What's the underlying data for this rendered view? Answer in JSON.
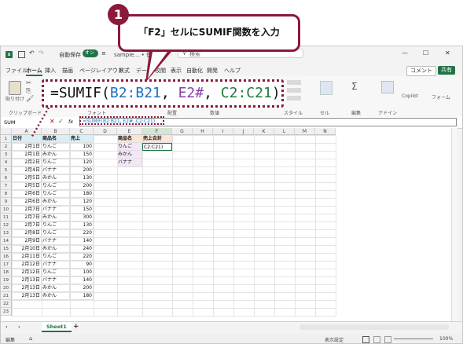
{
  "callout": {
    "badge": "1",
    "text": "「F2」セルにSUMIF関数を入力"
  },
  "zoom": {
    "prefix": "=SUMIF(",
    "ref1": "B2:B21",
    "sep1": ", ",
    "ref2": "E2#",
    "sep2": ", ",
    "ref3": "C2:C21",
    "suffix": ")"
  },
  "titlebar": {
    "autosave": "自動保存",
    "toggle": "オン",
    "filename": "sample… • 保存済み",
    "search": "検索"
  },
  "menu": [
    "ファイル",
    "ホーム",
    "挿入",
    "描画",
    "ページレイアウト",
    "数式",
    "データ",
    "校閲",
    "表示",
    "自動化",
    "開発",
    "ヘルプ"
  ],
  "ribbon": {
    "comment": "コメント",
    "share": "共有",
    "clipboard": "クリップボード",
    "paste": "貼り付け",
    "font": "フォント",
    "align": "配置",
    "number": "数値",
    "style": "スタイル",
    "cells": "セル",
    "edit": "編集",
    "addin": "アドイン",
    "copilot": "Copilot",
    "form": "フォーム"
  },
  "formula_bar": {
    "namebox": "SUM",
    "fx": "fx",
    "content": "=SUMIF(B2:B21, E2#, C2:C21)"
  },
  "columns": [
    "A",
    "B",
    "C",
    "D",
    "E",
    "F",
    "G",
    "H",
    "I",
    "J",
    "K",
    "L",
    "M",
    "N"
  ],
  "table": {
    "headers": [
      "日付",
      "商品名",
      "売上"
    ],
    "rows": [
      [
        "2月1日",
        "りんご",
        "100"
      ],
      [
        "2月1日",
        "みかん",
        "150"
      ],
      [
        "2月2日",
        "りんご",
        "120"
      ],
      [
        "2月4日",
        "バナナ",
        "200"
      ],
      [
        "2月5日",
        "みかん",
        "130"
      ],
      [
        "2月5日",
        "りんご",
        "200"
      ],
      [
        "2月6日",
        "りんご",
        "180"
      ],
      [
        "2月6日",
        "みかん",
        "120"
      ],
      [
        "2月7日",
        "バナナ",
        "150"
      ],
      [
        "2月7日",
        "みかん",
        "300"
      ],
      [
        "2月7日",
        "りんご",
        "130"
      ],
      [
        "2月8日",
        "りんご",
        "220"
      ],
      [
        "2月9日",
        "バナナ",
        "140"
      ],
      [
        "2月10日",
        "みかん",
        "240"
      ],
      [
        "2月11日",
        "りんご",
        "220"
      ],
      [
        "2月12日",
        "バナナ",
        "90"
      ],
      [
        "2月12日",
        "りんご",
        "100"
      ],
      [
        "2月13日",
        "バナナ",
        "140"
      ],
      [
        "2月13日",
        "みかん",
        "200"
      ],
      [
        "2月13日",
        "みかん",
        "180"
      ]
    ]
  },
  "summary": {
    "headers": [
      "商品名",
      "売上合計"
    ],
    "f2": "C2:C21)",
    "items": [
      "りんご",
      "みかん",
      "バナナ"
    ]
  },
  "row_numbers": [
    "1",
    "2",
    "3",
    "4",
    "5",
    "6",
    "7",
    "8",
    "9",
    "10",
    "11",
    "12",
    "13",
    "14",
    "15",
    "16",
    "17",
    "18",
    "19",
    "20",
    "21",
    "22",
    "23"
  ],
  "sheet": {
    "tab": "Sheet1",
    "add": "+"
  },
  "status": {
    "mode": "編集",
    "display": "表示設定",
    "zoom": "100%"
  },
  "colors": {
    "accent": "#8b1a3a",
    "excel_green": "#217346",
    "header_fill": "#d9eef7",
    "summary_header": "#fbe5d6",
    "summary_items": "#f2e6f7"
  }
}
